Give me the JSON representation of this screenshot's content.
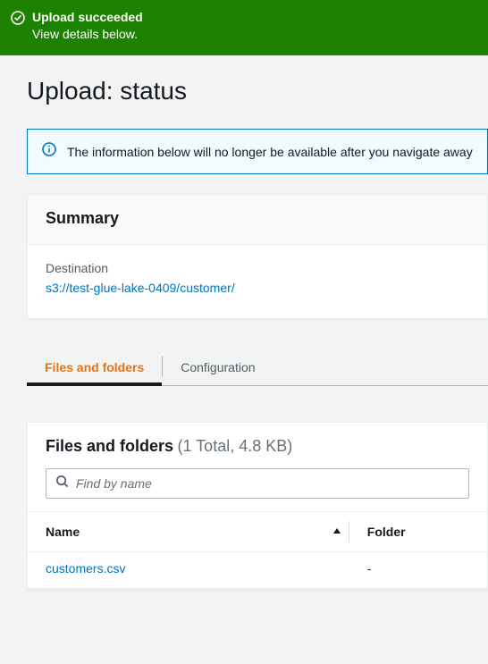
{
  "banner": {
    "title": "Upload succeeded",
    "subtitle": "View details below."
  },
  "page_title": "Upload: status",
  "info_notice": "The information below will no longer be available after you navigate away",
  "summary": {
    "header": "Summary",
    "destination_label": "Destination",
    "destination_value": "s3://test-glue-lake-0409/customer/"
  },
  "tabs": {
    "files": "Files and folders",
    "config": "Configuration"
  },
  "files_section": {
    "title": "Files and folders",
    "count_label": "(1 Total, 4.8 KB)",
    "search_placeholder": "Find by name",
    "columns": {
      "name": "Name",
      "folder": "Folder"
    },
    "rows": [
      {
        "name": "customers.csv",
        "folder": "-"
      }
    ]
  }
}
